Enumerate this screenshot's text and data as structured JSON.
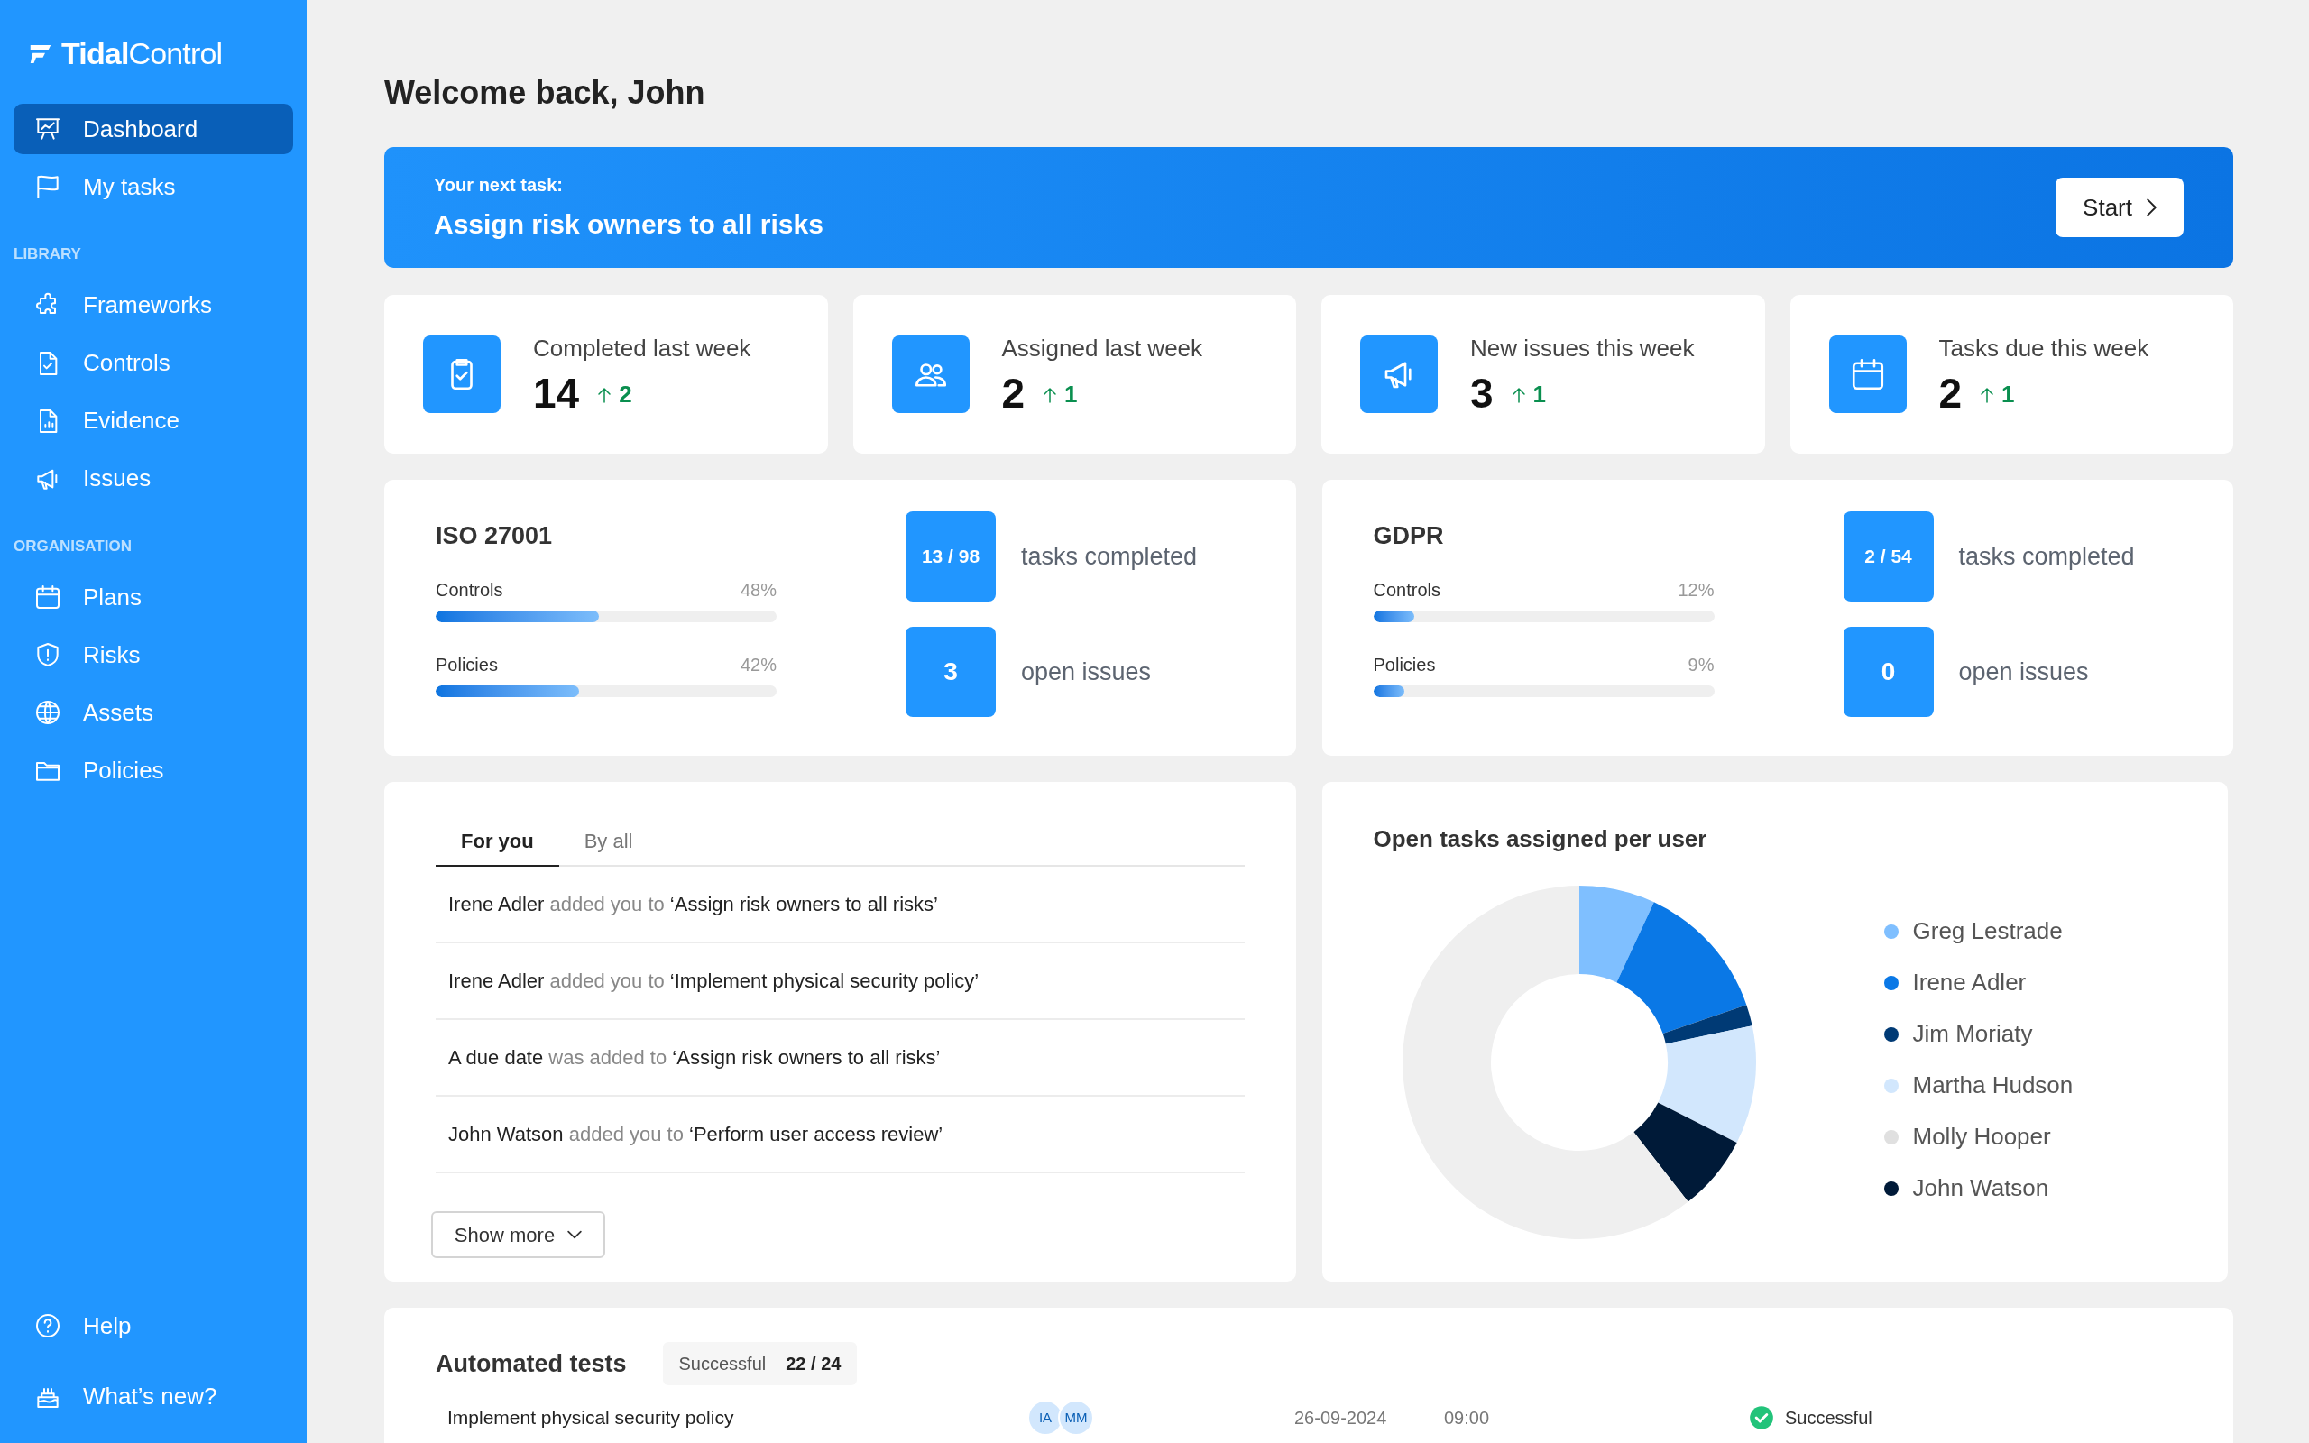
{
  "sidebar": {
    "logo": "**Tidal**Control",
    "sections": [
      {
        "items": [
          {
            "label": "Dashboard",
            "selected": true
          },
          {
            "label": "My tasks",
            "selected": false
          }
        ]
      },
      {
        "heading": "LIBRARY",
        "items": [
          {
            "label": "Frameworks",
            "selected": false
          },
          {
            "label": "Controls",
            "selected": false
          },
          {
            "label": "Evidence",
            "selected": false
          },
          {
            "label": "Issues",
            "selected": false
          }
        ]
      },
      {
        "heading": "ORGANISATION",
        "items": [
          {
            "label": "Plans",
            "selected": false
          },
          {
            "label": "Risks",
            "selected": false
          },
          {
            "label": "Assets",
            "selected": false
          },
          {
            "label": "Policies",
            "selected": false
          }
        ]
      }
    ],
    "footer_items": [
      {
        "label": "Help"
      },
      {
        "label": "What’s new?"
      }
    ]
  },
  "greeting": "Welcome back, John",
  "next_task": {
    "label": "Your next task:",
    "title": "Assign risk owners to all risks",
    "button": "Start"
  },
  "stats": [
    {
      "label": "Completed last week",
      "value": "14",
      "delta": "2"
    },
    {
      "label": "Assigned last week",
      "value": "2",
      "delta": "1"
    },
    {
      "label": "New issues this week",
      "value": "3",
      "delta": "1"
    },
    {
      "label": "Tasks due this week",
      "value": "2",
      "delta": "1"
    }
  ],
  "frameworks": [
    {
      "name": "ISO 27001",
      "bars": [
        {
          "label": "Controls",
          "percent": "48%",
          "level": 0.48
        },
        {
          "label": "Policies",
          "percent": "42%",
          "level": 0.42
        }
      ],
      "tasks": "13 / 98",
      "tasks_label": "tasks completed",
      "issues": "3",
      "issues_label": "open issues"
    },
    {
      "name": "GDPR",
      "bars": [
        {
          "label": "Controls",
          "percent": "12%",
          "level": 0.12
        },
        {
          "label": "Policies",
          "percent": "9%",
          "level": 0.09
        }
      ],
      "tasks": "2 / 54",
      "tasks_label": "tasks completed",
      "issues": "0",
      "issues_label": "open issues"
    }
  ],
  "activity": {
    "tabs": [
      {
        "label": "For you",
        "selected": true
      },
      {
        "label": "By all",
        "selected": false
      }
    ],
    "items": [
      "**Irene Adler** added you to **‘Assign risk owners to all risks’**",
      "**Irene Adler** added you to **‘Implement physical security policy’**",
      "**A due date** was added to **‘Assign risk owners to all risks’**",
      "**John Watson** added you to **‘Perform user access review’**"
    ],
    "button": "Show more"
  },
  "user_chart": {
    "title": "Open tasks assigned per user",
    "legend": [
      {
        "name": "Greg Lestrade",
        "color": "#7fbfff"
      },
      {
        "name": "Irene Adler",
        "color": "#0a78e6"
      },
      {
        "name": "Jim Moriaty",
        "color": "#003a75"
      },
      {
        "name": "Martha Hudson",
        "color": "#d2e7fd"
      },
      {
        "name": "Molly Hooper",
        "color": "#e0e0e0"
      },
      {
        "name": "John Watson",
        "color": "#001a38"
      }
    ]
  },
  "automated_tests": {
    "title": "Automated tests",
    "badge_label": "Successful",
    "badge_value": "22 / 24",
    "rows": [
      {
        "name": "Implement physical security policy",
        "avatars": [
          "IA",
          "MM"
        ],
        "date": "26-09-2024",
        "time": "09:00",
        "status": "Successful"
      }
    ]
  }
}
